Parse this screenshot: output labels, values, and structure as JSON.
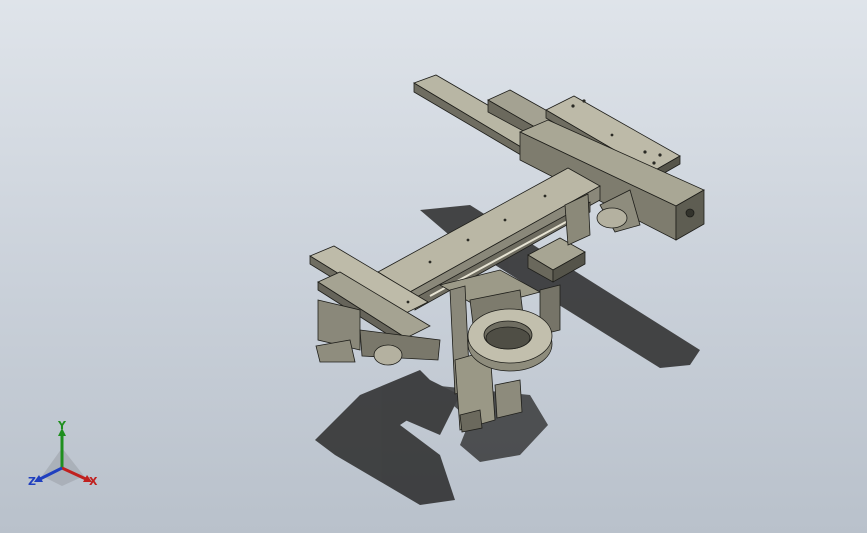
{
  "viewport": {
    "background_top": "#dfe4ea",
    "background_bottom": "#b9c1cb",
    "model_color": "#8d8b7b",
    "model_highlight": "#c9c6b4",
    "model_shadow": "#55544a",
    "edge_color": "#1e1e1a",
    "floor_shadow_color": "#2a2a2a"
  },
  "triad": {
    "x_label": "X",
    "y_label": "Y",
    "z_label": "Z",
    "x_color": "#c0201e",
    "y_color": "#1f8f1f",
    "z_color": "#1f3fbf"
  }
}
